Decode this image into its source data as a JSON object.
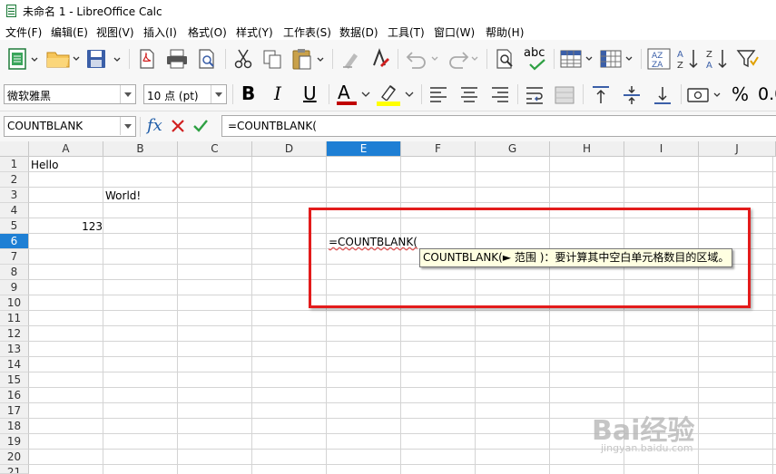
{
  "window": {
    "title": "未命名 1 - LibreOffice Calc"
  },
  "menu": [
    {
      "label": "文件(F)"
    },
    {
      "label": "编辑(E)"
    },
    {
      "label": "视图(V)"
    },
    {
      "label": "插入(I)"
    },
    {
      "label": "格式(O)"
    },
    {
      "label": "样式(Y)"
    },
    {
      "label": "工作表(S)"
    },
    {
      "label": "数据(D)"
    },
    {
      "label": "工具(T)"
    },
    {
      "label": "窗口(W)"
    },
    {
      "label": "帮助(H)"
    }
  ],
  "toolbar": {
    "font_name": "微软雅黑",
    "font_size": "10 点 (pt)",
    "bold_label": "B",
    "italic_label": "I",
    "underline_label": "U",
    "font_color_label": "A",
    "spell_label": "abc",
    "percent_label": "%",
    "number_format_label": "0.0",
    "font_color": "#c00000",
    "highlight_color": "#ffff00"
  },
  "formula_bar": {
    "name_box": "COUNTBLANK",
    "fx_label": "fx",
    "formula": "=COUNTBLANK("
  },
  "sheet": {
    "columns": [
      "A",
      "B",
      "C",
      "D",
      "E",
      "F",
      "G",
      "H",
      "I",
      "J"
    ],
    "rows": [
      "1",
      "2",
      "3",
      "4",
      "5",
      "6",
      "7",
      "8",
      "9",
      "10",
      "11",
      "12",
      "13",
      "14",
      "15",
      "16",
      "17",
      "18",
      "19",
      "20",
      "21"
    ],
    "active_column": "E",
    "active_row": "6",
    "cells": {
      "A1": "Hello",
      "B3": "World!",
      "A5": "123",
      "E6": "=COUNTBLANK("
    }
  },
  "tooltip": {
    "text": "COUNTBLANK(► 范围 )：要计算其中空白单元格数目的区域。"
  },
  "watermark": {
    "text": "Bai经验",
    "url": "jingyan.baidu.com"
  },
  "colors": {
    "accent": "#1e7fd4",
    "highlight_box": "#e31b1b",
    "tooltip_bg": "#ffffe1"
  }
}
